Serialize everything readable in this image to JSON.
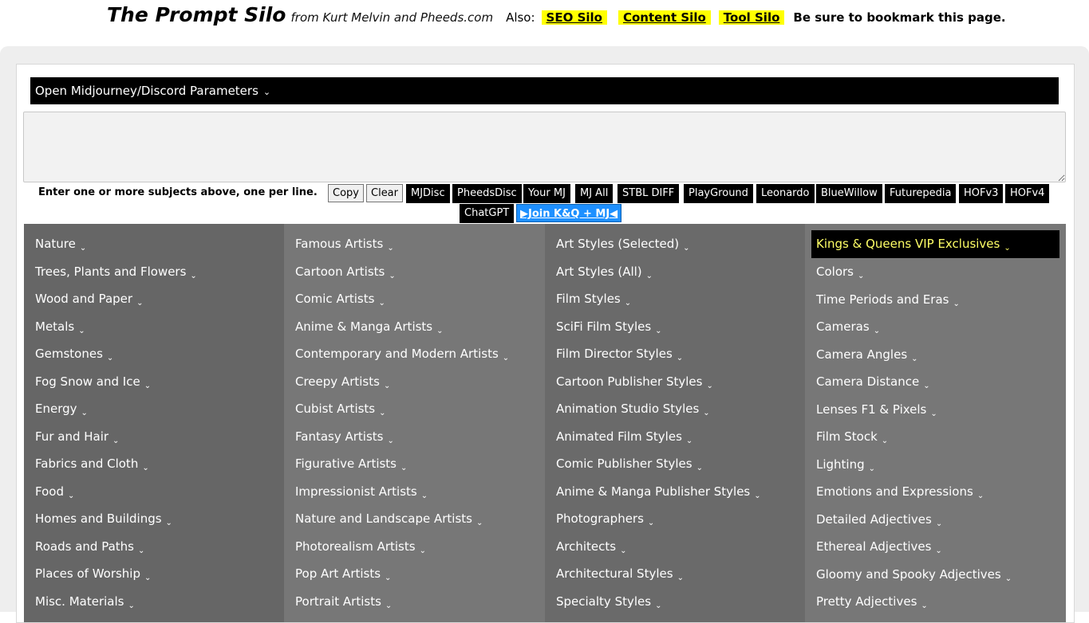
{
  "header": {
    "title": "The Prompt Silo",
    "byline": "from Kurt Melvin and Pheeds.com",
    "also": "Also:",
    "links": [
      "SEO Silo",
      "Content Silo",
      "Tool Silo"
    ],
    "bookmark": "Be sure to bookmark this page."
  },
  "params_bar": {
    "label": "Open Midjourney/Discord Parameters",
    "chevron": "⌄"
  },
  "input": {
    "value": "",
    "placeholder": ""
  },
  "hint": "Enter one or more subjects above, one per line.",
  "buttons": {
    "copy": "Copy",
    "clear": "Clear",
    "dark_row1": [
      "MJDisc",
      "PheedsDisc",
      "Your MJ",
      "MJ All",
      "STBL DIFF",
      "PlayGround",
      "Leonardo",
      "BlueWillow",
      "Futurepedia",
      "HOFv3",
      "HOFv4"
    ],
    "chatgpt": "ChatGPT",
    "join": "▶Join K&Q + MJ◀"
  },
  "columns": [
    [
      "Nature",
      "Trees, Plants and Flowers",
      "Wood and Paper",
      "Metals",
      "Gemstones",
      "Fog Snow and Ice",
      "Energy",
      "Fur and Hair",
      "Fabrics and Cloth",
      "Food",
      "Homes and Buildings",
      "Roads and Paths",
      "Places of Worship",
      "Misc. Materials"
    ],
    [
      "Famous Artists",
      "Cartoon Artists",
      "Comic Artists",
      "Anime & Manga Artists",
      "Contemporary and Modern Artists",
      "Creepy Artists",
      "Cubist Artists",
      "Fantasy Artists",
      "Figurative Artists",
      "Impressionist Artists",
      "Nature and Landscape Artists",
      "Photorealism Artists",
      "Pop Art Artists",
      "Portrait Artists"
    ],
    [
      "Art Styles (Selected)",
      "Art Styles (All)",
      "Film Styles",
      "SciFi Film Styles",
      "Film Director Styles",
      "Cartoon Publisher Styles",
      "Animation Studio Styles",
      "Animated Film Styles",
      "Comic Publisher Styles",
      "Anime & Manga Publisher Styles",
      "Photographers",
      "Architects",
      "Architectural Styles",
      "Specialty Styles"
    ],
    [
      "Kings & Queens VIP Exclusives",
      "Colors",
      "Time Periods and Eras",
      "Cameras",
      "Camera Angles",
      "Camera Distance",
      "Lenses F1 & Pixels",
      "Film Stock",
      "Lighting",
      "Emotions and Expressions",
      "Detailed Adjectives",
      "Ethereal Adjectives",
      "Gloomy and Spooky Adjectives",
      "Pretty Adjectives"
    ]
  ],
  "colors": {
    "highlight": "#ffff00",
    "vip_text": "#ffff66",
    "join_bg": "#1e90ff"
  }
}
